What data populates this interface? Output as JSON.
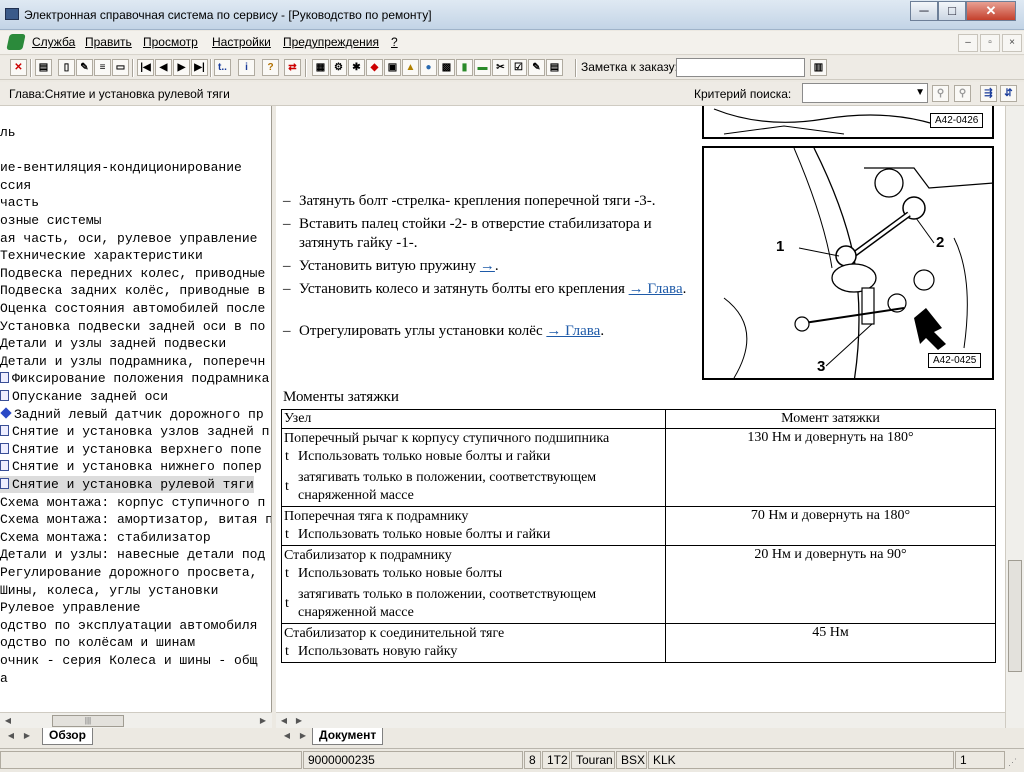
{
  "window": {
    "title": "Электронная справочная система по сервису - [Руководство по ремонту]",
    "min": "─",
    "max": "□",
    "close": "✕"
  },
  "menu": {
    "items": [
      "Служба",
      "Править",
      "Просмотр",
      "Настройки",
      "Предупреждения",
      "?"
    ],
    "mdi": [
      "–",
      "▫",
      "×"
    ]
  },
  "toolbar": {
    "note_label": "Заметка к заказу:",
    "note_value": "",
    "btn_t1": "t..",
    "btn_info": "i",
    "btn_help": "?",
    "btn_swap": "⇄"
  },
  "chapter": {
    "label": "Глава:Снятие и установка рулевой тяги"
  },
  "search": {
    "label": "Критерий  поиска:",
    "value": "",
    "arrow": "▼"
  },
  "tree": {
    "items": [
      {
        "text": "ль",
        "icon": "",
        "selected": false
      },
      {
        "text": "",
        "icon": "",
        "selected": false
      },
      {
        "text": "ие-вентиляция-кондиционирование",
        "icon": "",
        "selected": false
      },
      {
        "text": "ссия",
        "icon": "",
        "selected": false
      },
      {
        "text": " часть",
        "icon": "",
        "selected": false
      },
      {
        "text": "озные системы",
        "icon": "",
        "selected": false
      },
      {
        "text": "ая часть, оси, рулевое управление",
        "icon": "",
        "selected": false
      },
      {
        "text": " Технические характеристики",
        "icon": "",
        "selected": false
      },
      {
        "text": " Подвеска передних колес, приводные",
        "icon": "",
        "selected": false
      },
      {
        "text": " Подвеска задних колёс, приводные в",
        "icon": "",
        "selected": false
      },
      {
        "text": " Оценка состояния автомобилей после",
        "icon": "",
        "selected": false
      },
      {
        "text": "Установка подвески задней оси в по",
        "icon": "",
        "selected": false
      },
      {
        "text": "Детали и узлы задней подвески",
        "icon": "",
        "selected": false
      },
      {
        "text": "Детали и узлы подрамника, поперечн",
        "icon": "",
        "selected": false
      },
      {
        "text": "Фиксирование положения подрамника",
        "icon": "page",
        "selected": false
      },
      {
        "text": "Опускание задней оси",
        "icon": "page",
        "selected": false
      },
      {
        "text": "Задний левый датчик дорожного пр",
        "icon": "diamond",
        "selected": false
      },
      {
        "text": "Снятие и установка узлов задней п",
        "icon": "page",
        "selected": false
      },
      {
        "text": "Снятие и установка верхнего попе",
        "icon": "page",
        "selected": false
      },
      {
        "text": "Снятие и установка нижнего попер",
        "icon": "page",
        "selected": false
      },
      {
        "text": "Снятие и установка рулевой тяги",
        "icon": "page",
        "selected": true
      },
      {
        "text": "Схема монтажа: корпус ступичного п",
        "icon": "",
        "selected": false
      },
      {
        "text": "Схема монтажа: амортизатор, витая п",
        "icon": "",
        "selected": false
      },
      {
        "text": "Схема монтажа: стабилизатор",
        "icon": "",
        "selected": false
      },
      {
        "text": "Детали и узлы: навесные детали под",
        "icon": "",
        "selected": false
      },
      {
        "text": " Регулирование дорожного просвета,",
        "icon": "",
        "selected": false
      },
      {
        "text": " Шины, колеса, углы установки",
        "icon": "",
        "selected": false
      },
      {
        "text": " Рулевое управление",
        "icon": "",
        "selected": false
      },
      {
        "text": "одство по эксплуатации автомобиля",
        "icon": "",
        "selected": false
      },
      {
        "text": "одство по колёсам и шинам",
        "icon": "",
        "selected": false
      },
      {
        "text": "очник - серия Колеса и шины - общ",
        "icon": "",
        "selected": false
      },
      {
        "text": "а",
        "icon": "",
        "selected": false
      }
    ],
    "tab": "Обзор"
  },
  "doc": {
    "steps": [
      {
        "text": "Затянуть болт -стрелка- крепления поперечной тяги -3-.",
        "link": "",
        "after": ""
      },
      {
        "text": "Вставить палец стойки -2- в отверстие стабилизатора и затянуть гайку -1-.",
        "link": "",
        "after": ""
      },
      {
        "text": "Установить витую пружину ",
        "link": "→",
        "after": "."
      },
      {
        "text": "Установить колесо и затянуть болты его крепления ",
        "link": "→ Глава",
        "after": "."
      },
      {
        "text": "Отрегулировать углы установки колёс ",
        "link": "→ Глава",
        "after": "."
      }
    ],
    "dash": "–",
    "figure_top_label": "A42-0426",
    "figure_label": "A42-0425",
    "callouts": [
      "1",
      "2",
      "3"
    ],
    "moments_title": "Моменты затяжки",
    "table_headers": [
      "Узел",
      "Момент затяжки"
    ],
    "tick": "t",
    "table_rows": [
      {
        "name": "Поперечный рычаг к корпусу ступичного подшипника",
        "value": "130 Нм и довернуть на 180°",
        "notes": [
          "Использовать только новые болты и гайки",
          "затягивать только в положении, соответствующем снаряженной массе"
        ]
      },
      {
        "name": "Поперечная тяга к подрамнику",
        "value": "70 Нм и довернуть на 180°",
        "notes": [
          "Использовать только новые болты и гайки"
        ]
      },
      {
        "name": "Стабилизатор к подрамнику",
        "value": "20 Нм и довернуть на 90°",
        "notes": [
          "Использовать только новые болты",
          "затягивать только в положении, соответствующем снаряженной массе"
        ]
      },
      {
        "name": "Стабилизатор к соединительной тяге",
        "value": "45 Нм",
        "notes": [
          "Использовать новую гайку"
        ]
      }
    ],
    "tab": "Документ"
  },
  "status": {
    "order": "9000000235",
    "s1": "8",
    "s2": "1T2",
    "s3": "Touran",
    "s4": "BSX",
    "s5": "KLK",
    "s6": "1"
  },
  "scroll": {
    "left": "◀",
    "right": "▶",
    "grip": "|||"
  }
}
